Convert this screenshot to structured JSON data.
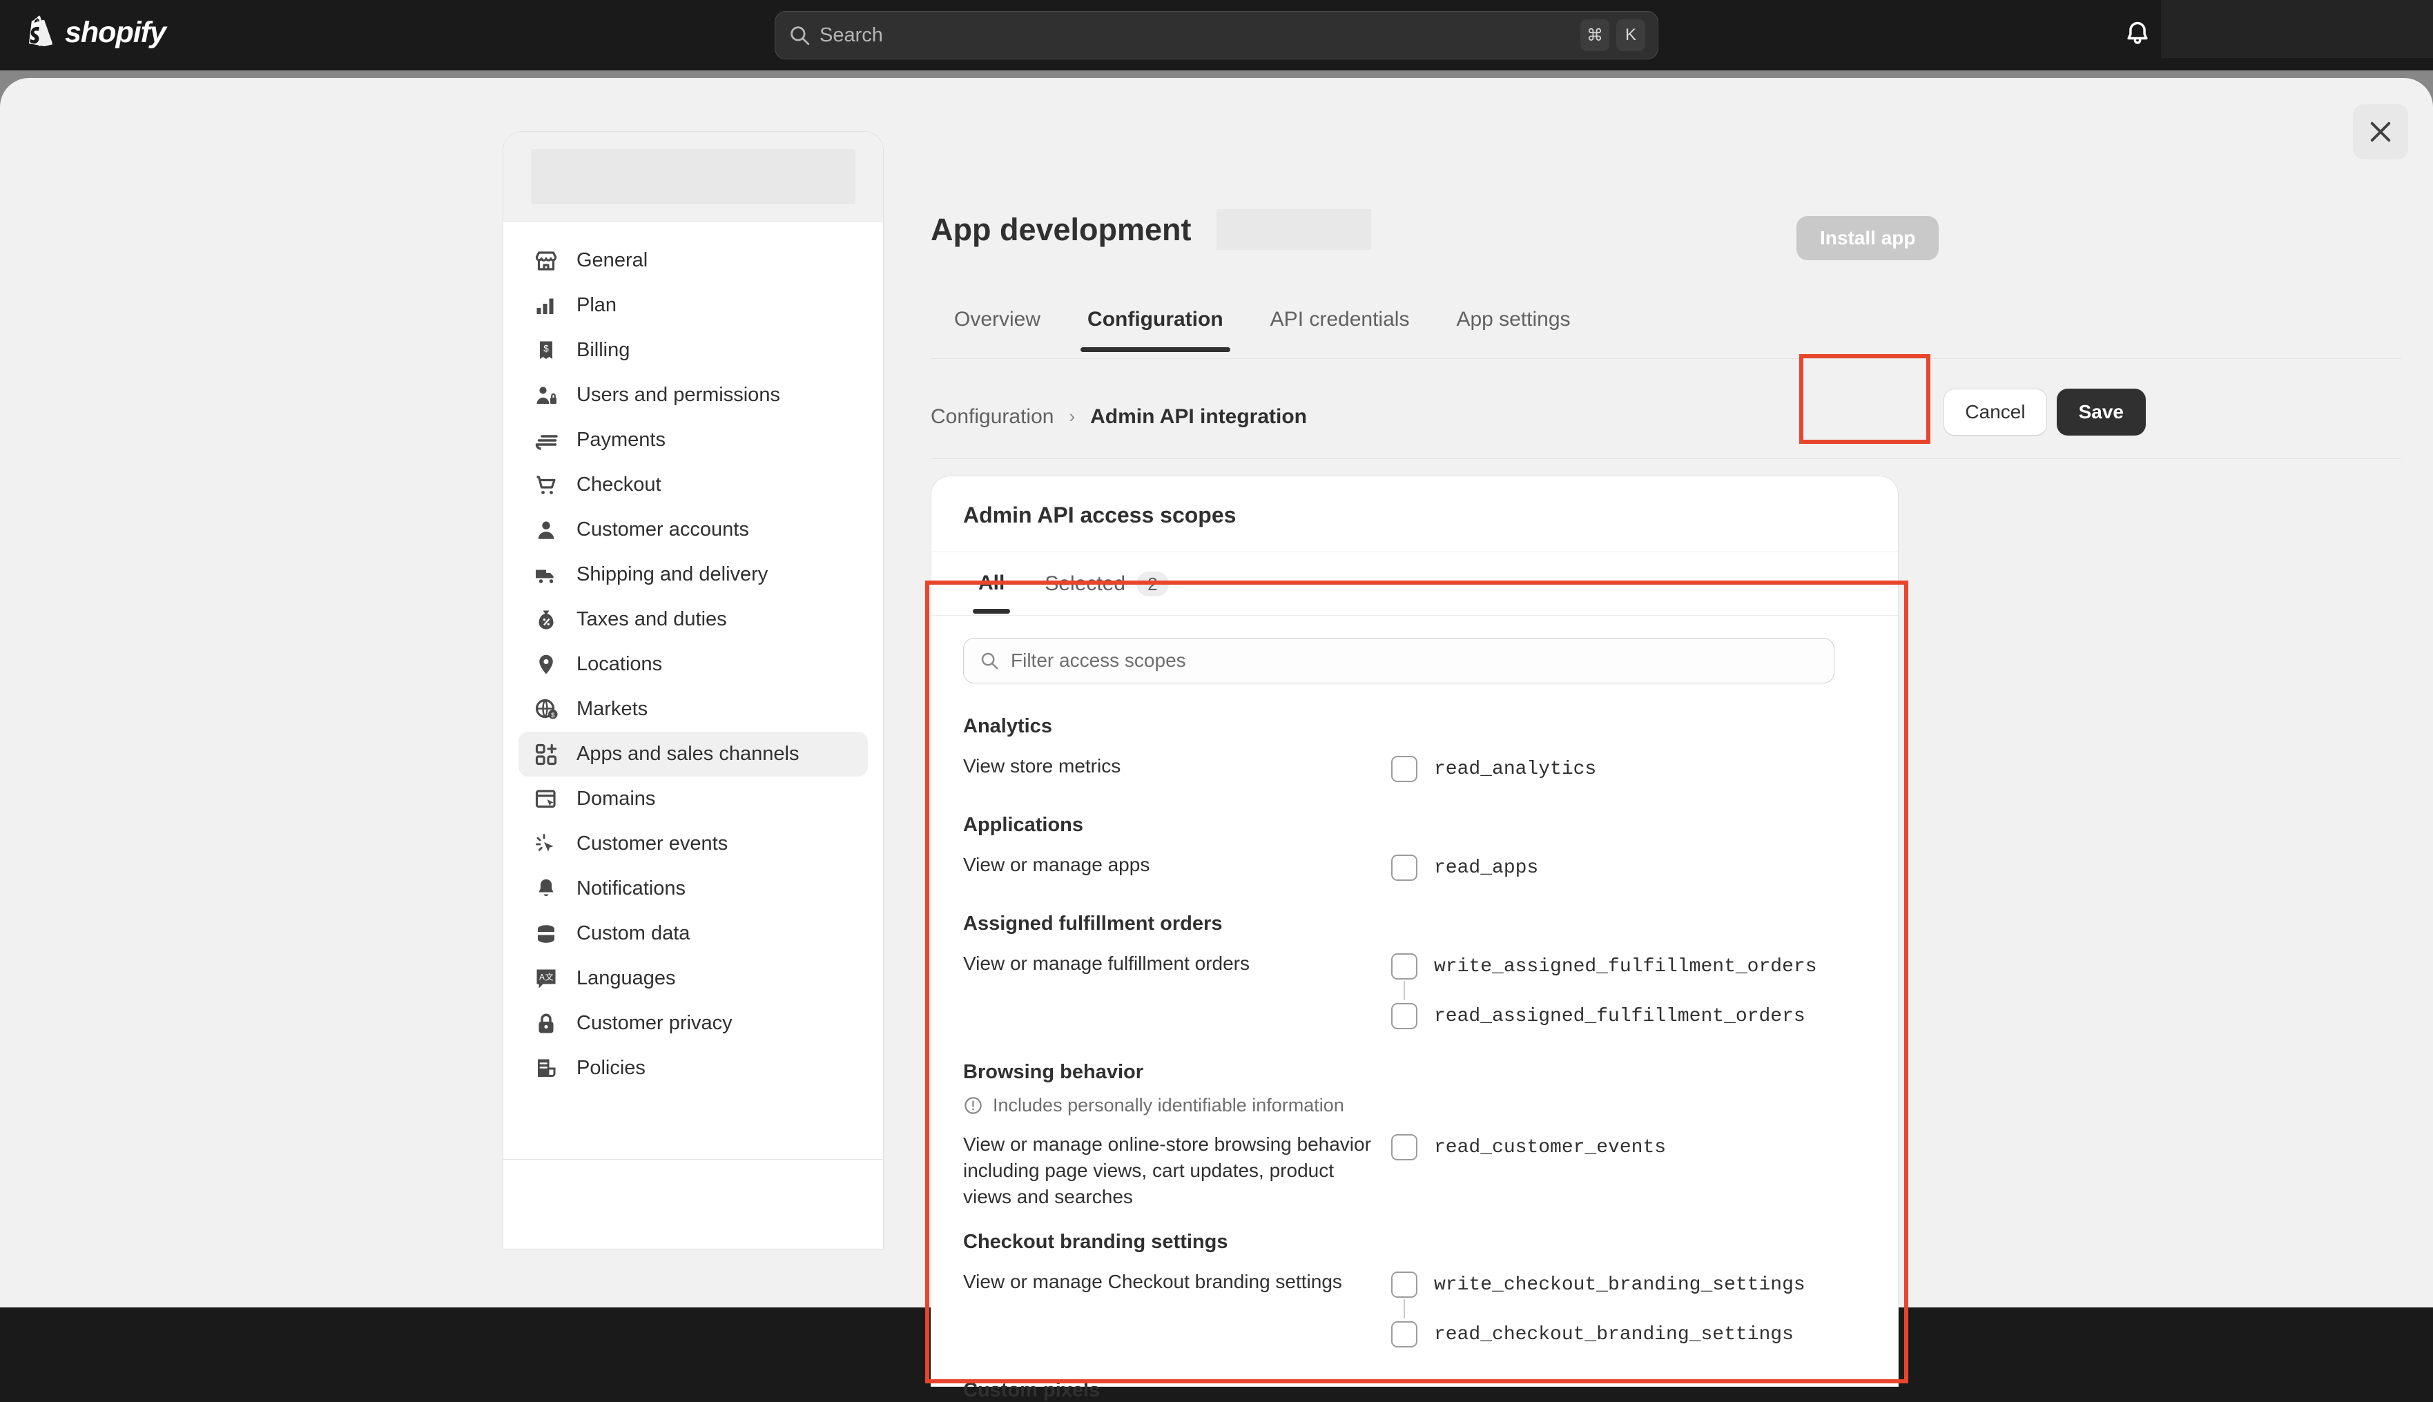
{
  "topbar": {
    "brand": "shopify",
    "brand_icon": "shopify-bag-icon",
    "search": {
      "placeholder": "Search",
      "icon": "search-icon",
      "kbd_cmd": "⌘",
      "kbd_key": "K"
    },
    "notifications_icon": "bell-icon"
  },
  "modal": {
    "close_icon": "close-icon"
  },
  "sidebar": {
    "items": [
      {
        "label": "General",
        "icon": "store-icon"
      },
      {
        "label": "Plan",
        "icon": "chart-bar-icon"
      },
      {
        "label": "Billing",
        "icon": "receipt-dollar-icon"
      },
      {
        "label": "Users and permissions",
        "icon": "person-lock-icon"
      },
      {
        "label": "Payments",
        "icon": "credit-card-icon"
      },
      {
        "label": "Checkout",
        "icon": "cart-icon"
      },
      {
        "label": "Customer accounts",
        "icon": "person-icon"
      },
      {
        "label": "Shipping and delivery",
        "icon": "delivery-truck-icon"
      },
      {
        "label": "Taxes and duties",
        "icon": "money-bag-percent-icon"
      },
      {
        "label": "Locations",
        "icon": "location-pin-icon"
      },
      {
        "label": "Markets",
        "icon": "globe-dollar-icon"
      },
      {
        "label": "Apps and sales channels",
        "icon": "apps-grid-plus-icon",
        "active": true
      },
      {
        "label": "Domains",
        "icon": "domain-cursor-icon"
      },
      {
        "label": "Customer events",
        "icon": "click-sparkle-icon"
      },
      {
        "label": "Notifications",
        "icon": "bell-icon"
      },
      {
        "label": "Custom data",
        "icon": "database-icon"
      },
      {
        "label": "Languages",
        "icon": "translate-icon"
      },
      {
        "label": "Customer privacy",
        "icon": "lock-icon"
      },
      {
        "label": "Policies",
        "icon": "policy-document-icon"
      }
    ]
  },
  "main": {
    "page_title": "App development",
    "install_button": "Install app",
    "tabs": [
      {
        "label": "Overview",
        "active": false
      },
      {
        "label": "Configuration",
        "active": true
      },
      {
        "label": "API credentials",
        "active": false
      },
      {
        "label": "App settings",
        "active": false
      }
    ],
    "breadcrumb": {
      "parent": "Configuration",
      "separator": "›",
      "current": "Admin API integration"
    },
    "cancel_button": "Cancel",
    "save_button": "Save"
  },
  "scopes_card": {
    "title": "Admin API access scopes",
    "tabs": [
      {
        "label": "All",
        "active": true,
        "count": null
      },
      {
        "label": "Selected",
        "active": false,
        "count": "2"
      }
    ],
    "filter": {
      "placeholder": "Filter access scopes",
      "icon": "search-icon"
    },
    "groups": [
      {
        "title": "Analytics",
        "pii": null,
        "description": "View store metrics",
        "scopes": [
          {
            "code": "read_analytics",
            "checked": false
          }
        ]
      },
      {
        "title": "Applications",
        "pii": null,
        "description": "View or manage apps",
        "scopes": [
          {
            "code": "read_apps",
            "checked": false
          }
        ]
      },
      {
        "title": "Assigned fulfillment orders",
        "pii": null,
        "description": "View or manage fulfillment orders",
        "scopes": [
          {
            "code": "write_assigned_fulfillment_orders",
            "checked": false
          },
          {
            "code": "read_assigned_fulfillment_orders",
            "checked": false
          }
        ]
      },
      {
        "title": "Browsing behavior",
        "pii": "Includes personally identifiable information",
        "pii_icon": "info-circle-icon",
        "description": "View or manage online-store browsing behavior including page views, cart updates, product views and searches",
        "scopes": [
          {
            "code": "read_customer_events",
            "checked": false
          }
        ]
      },
      {
        "title": "Checkout branding settings",
        "pii": null,
        "description": "View or manage Checkout branding settings",
        "scopes": [
          {
            "code": "write_checkout_branding_settings",
            "checked": false
          },
          {
            "code": "read_checkout_branding_settings",
            "checked": false
          }
        ]
      },
      {
        "title": "Custom pixels",
        "pii": null,
        "description": null,
        "scopes": []
      }
    ]
  },
  "annotations": {
    "highlight_color": "#e8452c"
  }
}
